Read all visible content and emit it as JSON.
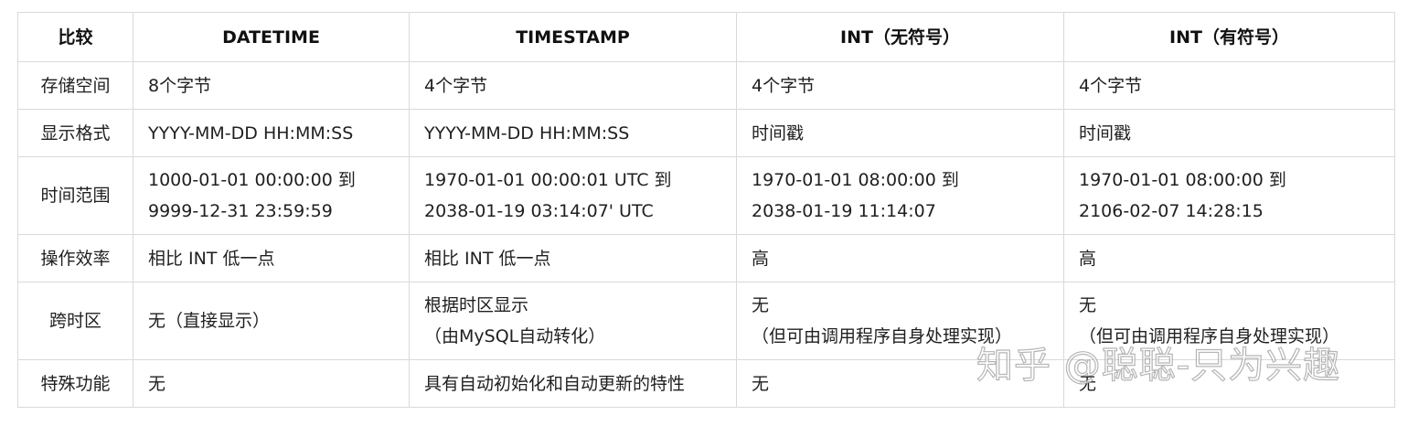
{
  "headers": [
    "比较",
    "DATETIME",
    "TIMESTAMP",
    "INT（无符号）",
    "INT（有符号）"
  ],
  "rows": [
    {
      "label": "存储空间",
      "cells": [
        [
          "8个字节"
        ],
        [
          "4个字节"
        ],
        [
          "4个字节"
        ],
        [
          "4个字节"
        ]
      ]
    },
    {
      "label": "显示格式",
      "cells": [
        [
          "YYYY-MM-DD HH:MM:SS"
        ],
        [
          "YYYY-MM-DD HH:MM:SS"
        ],
        [
          "时间戳"
        ],
        [
          "时间戳"
        ]
      ]
    },
    {
      "label": "时间范围",
      "cells": [
        [
          "1000-01-01 00:00:00 到",
          "9999-12-31 23:59:59"
        ],
        [
          "1970-01-01 00:00:01 UTC 到",
          "2038-01-19 03:14:07' UTC"
        ],
        [
          "1970-01-01 08:00:00 到",
          "2038-01-19 11:14:07"
        ],
        [
          "1970-01-01 08:00:00 到",
          "2106-02-07 14:28:15"
        ]
      ]
    },
    {
      "label": "操作效率",
      "cells": [
        [
          "相比 INT 低一点"
        ],
        [
          "相比 INT 低一点"
        ],
        [
          "高"
        ],
        [
          "高"
        ]
      ]
    },
    {
      "label": "跨时区",
      "cells": [
        [
          "无（直接显示）"
        ],
        [
          "根据时区显示",
          "（由MySQL自动转化）"
        ],
        [
          "无",
          "（但可由调用程序自身处理实现）"
        ],
        [
          "无",
          "（但可由调用程序自身处理实现）"
        ]
      ]
    },
    {
      "label": "特殊功能",
      "cells": [
        [
          "无"
        ],
        [
          "具有自动初始化和自动更新的特性"
        ],
        [
          "无"
        ],
        [
          "无"
        ]
      ]
    }
  ],
  "watermark": "知乎 @聪聪-只为兴趣"
}
